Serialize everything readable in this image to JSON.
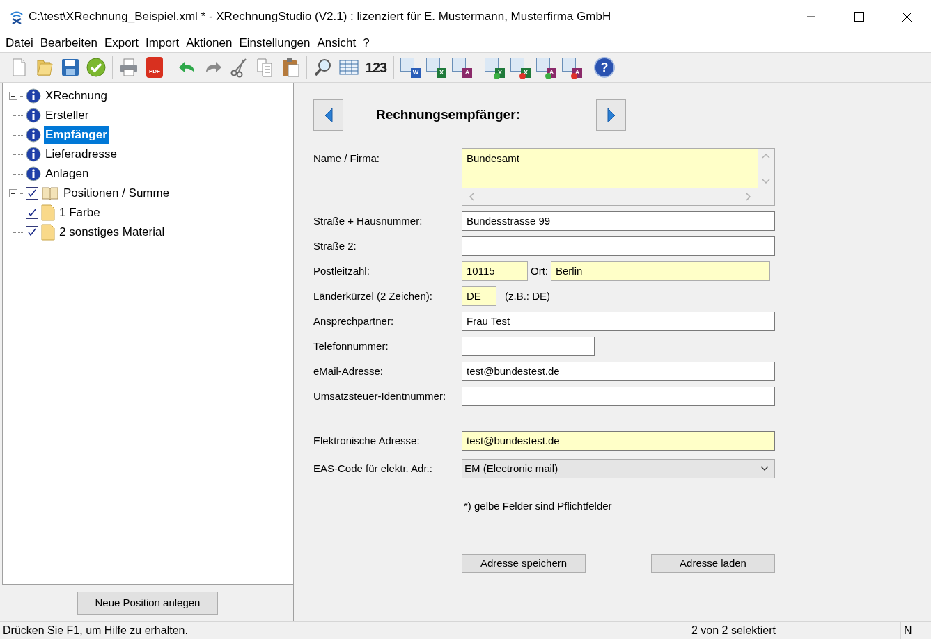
{
  "window": {
    "title": "C:\\test\\XRechnung_Beispiel.xml * - XRechnungStudio (V2.1) : lizenziert für E. Mustermann, Musterfirma GmbH"
  },
  "menu": [
    "Datei",
    "Bearbeiten",
    "Export",
    "Import",
    "Aktionen",
    "Einstellungen",
    "Ansicht",
    "?"
  ],
  "toolbar": [
    {
      "kind": "new"
    },
    {
      "kind": "open"
    },
    {
      "kind": "save"
    },
    {
      "kind": "validate"
    },
    {
      "kind": "separator"
    },
    {
      "kind": "print"
    },
    {
      "kind": "pdf",
      "label": "PDF"
    },
    {
      "kind": "separator"
    },
    {
      "kind": "undo"
    },
    {
      "kind": "redo"
    },
    {
      "kind": "cut"
    },
    {
      "kind": "copy"
    },
    {
      "kind": "paste"
    },
    {
      "kind": "separator"
    },
    {
      "kind": "search"
    },
    {
      "kind": "table"
    },
    {
      "kind": "numbers",
      "label": "123"
    },
    {
      "kind": "separator"
    },
    {
      "kind": "export",
      "label": "W",
      "color": "#2b5eb8"
    },
    {
      "kind": "export",
      "label": "X",
      "color": "#1f7a3a"
    },
    {
      "kind": "export",
      "label": "A",
      "color": "#8b2a6a"
    },
    {
      "kind": "separator"
    },
    {
      "kind": "import-add",
      "label": "X",
      "color": "#1f7a3a"
    },
    {
      "kind": "import-replace",
      "label": "X",
      "color": "#1f7a3a"
    },
    {
      "kind": "import-add",
      "label": "A",
      "color": "#8b2a6a"
    },
    {
      "kind": "import-replace",
      "label": "A",
      "color": "#8b2a6a"
    },
    {
      "kind": "separator"
    },
    {
      "kind": "help",
      "label": "?"
    }
  ],
  "tree": [
    {
      "label": "XRechnung",
      "kind": "info",
      "expanded": true,
      "children": [
        {
          "label": "Ersteller",
          "kind": "info",
          "selected": false
        },
        {
          "label": "Empfänger",
          "kind": "info",
          "selected": true
        },
        {
          "label": "Lieferadresse",
          "kind": "info",
          "selected": false
        },
        {
          "label": "Anlagen",
          "kind": "info",
          "selected": false
        }
      ]
    },
    {
      "label": "Positionen / Summe",
      "kind": "book",
      "expanded": true,
      "checked": true,
      "children": [
        {
          "label": "1 Farbe",
          "kind": "doc",
          "checked": true,
          "selected": false
        },
        {
          "label": "2 sonstiges Material",
          "kind": "doc",
          "checked": true,
          "selected": false
        }
      ]
    }
  ],
  "new_position_button": "Neue Position anlegen",
  "form": {
    "title": "Rechnungsempfänger:",
    "address_fields": [
      {
        "kind": "multiline",
        "label": "Name / Firma:",
        "value": "Bundesamt",
        "required": true
      },
      {
        "kind": "text",
        "label": "Straße + Hausnummer:",
        "value": "Bundesstrasse 99",
        "required": false
      },
      {
        "kind": "text",
        "label": "Straße 2:",
        "required": false
      },
      {
        "kind": "postal",
        "label": "Postleitzahl:",
        "value": "10115",
        "required": true,
        "second_label": "Ort:",
        "second_value": "Berlin"
      },
      {
        "kind": "country",
        "label": "Länderkürzel (2 Zeichen):",
        "value": "DE",
        "required": true,
        "hint": "(z.B.: DE)"
      },
      {
        "kind": "text",
        "label": "Ansprechpartner:",
        "value": "Frau Test",
        "required": false
      },
      {
        "kind": "short-text",
        "label": "Telefonnummer:",
        "required": false
      },
      {
        "kind": "text",
        "label": "eMail-Adresse:",
        "value": "test@bundestest.de",
        "required": false
      },
      {
        "kind": "text",
        "label": "Umsatzsteuer-Identnummer:",
        "required": false
      }
    ],
    "electronic_fields": [
      {
        "kind": "text",
        "label": "Elektronische Adresse:",
        "value": "test@bundestest.de",
        "required": true
      },
      {
        "kind": "dropdown",
        "label": "EAS-Code für elektr. Adr.:",
        "value": "EM (Electronic mail)",
        "required": false
      }
    ],
    "note": "*) gelbe Felder sind Pflichtfelder",
    "buttons": [
      "Adresse speichern",
      "Adresse laden"
    ]
  },
  "status_bar": {
    "message": "Drücken Sie F1, um Hilfe zu erhalten.",
    "selection": "2 von 2 selektiert",
    "indicator": "N"
  }
}
